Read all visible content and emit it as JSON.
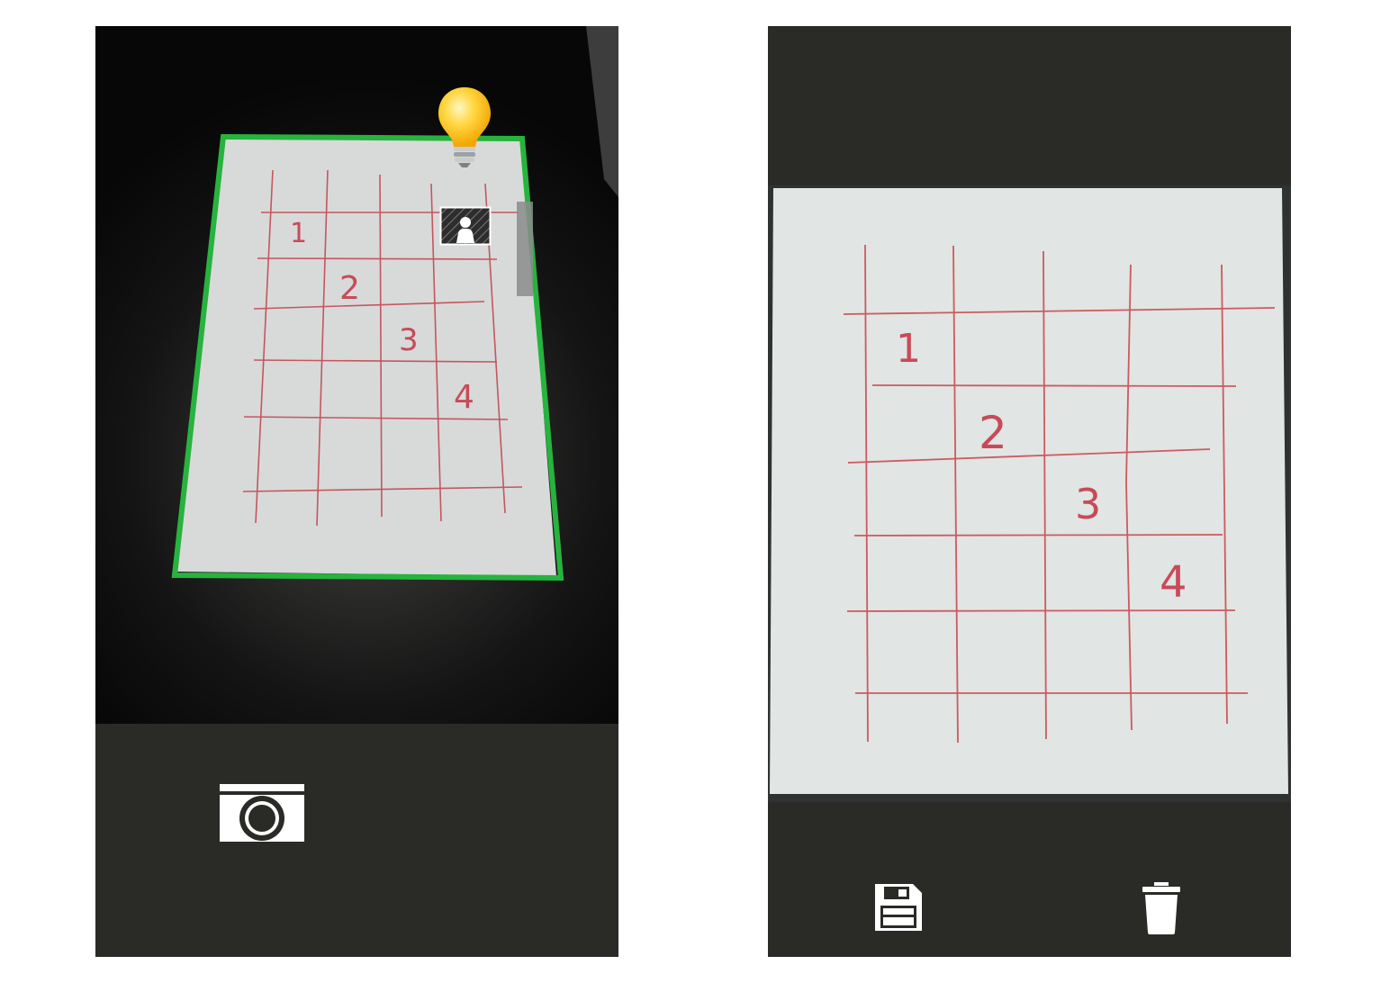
{
  "screens": {
    "camera": {
      "detected_outline_color": "#27b33d",
      "grid_numbers": [
        "1",
        "2",
        "3",
        "4"
      ],
      "icons": {
        "flash": "lightbulb-icon",
        "mode": "portrait-mode-icon",
        "capture": "camera-icon"
      }
    },
    "result": {
      "grid_numbers": [
        "1",
        "2",
        "3",
        "4"
      ],
      "icons": {
        "save": "floppy-disk-icon",
        "delete": "trash-icon"
      }
    }
  },
  "colors": {
    "toolbar": "#2a2b27",
    "ink": "#c84a58",
    "paper": "#dfe2e0"
  }
}
